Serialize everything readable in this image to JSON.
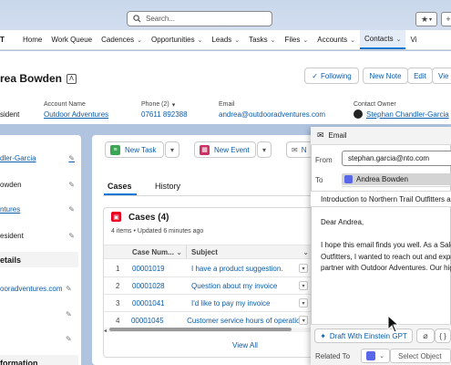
{
  "topbar": {
    "search_placeholder": "Search...",
    "nav_left_partial": "T"
  },
  "nav": {
    "items": [
      {
        "label": "Home",
        "chevron": false
      },
      {
        "label": "Work Queue",
        "chevron": false
      },
      {
        "label": "Cadences",
        "chevron": true
      },
      {
        "label": "Opportunities",
        "chevron": true
      },
      {
        "label": "Leads",
        "chevron": true
      },
      {
        "label": "Tasks",
        "chevron": true
      },
      {
        "label": "Files",
        "chevron": true
      },
      {
        "label": "Accounts",
        "chevron": true
      },
      {
        "label": "Contacts",
        "chevron": true
      },
      {
        "label": "Vi",
        "chevron": false
      }
    ],
    "active": "Contacts"
  },
  "record": {
    "name": "rea Bowden",
    "buttons": {
      "following": "Following",
      "new_note": "New Note",
      "edit": "Edit",
      "view": "Vie"
    },
    "fields": {
      "title_partial": "sident",
      "account_name_label": "Account Name",
      "account_name": "Outdoor Adventures",
      "phone_label": "Phone (2)",
      "phone": "07611 892388",
      "email_label": "Email",
      "email": "andrea@outdooradventures.com",
      "owner_label": "Contact Owner",
      "owner": "Stephan Chandler-Garcia"
    }
  },
  "left_panel": {
    "rows": [
      "dler-Garcia",
      "owden",
      "ntures",
      "esident"
    ],
    "section_details": "etails",
    "email_partial": "ooradventures.com",
    "section_bottom": "formation"
  },
  "actions": {
    "new_task": "New Task",
    "new_event": "New Event",
    "third_partial": "N"
  },
  "tabs": {
    "cases": "Cases",
    "history": "History"
  },
  "cases": {
    "title": "Cases (4)",
    "subtitle": "4 items • Updated 6 minutes ago",
    "col_number": "Case Num...",
    "col_subject": "Subject",
    "rows": [
      {
        "idx": "1",
        "number": "00001019",
        "subject": "I have a product suggestion."
      },
      {
        "idx": "2",
        "number": "00001028",
        "subject": "Question about my invoice"
      },
      {
        "idx": "3",
        "number": "00001041",
        "subject": "I'd like to pay my invoice"
      },
      {
        "idx": "4",
        "number": "00001045",
        "subject": "Customer service hours of operation."
      }
    ],
    "view_all": "View All"
  },
  "email": {
    "header": "Email",
    "from_label": "From",
    "from_value": "stephan.garcia@nto.com",
    "to_label": "To",
    "to_pill": "Andrea Bowden",
    "subject": "Introduction to Northern Trail Outfitters and",
    "body": [
      "Dear Andrea,",
      "",
      "I hope this email finds you well. As a Sales E",
      "Outfitters, I wanted to reach out and expres",
      "partner with Outdoor Adventures. Our high-"
    ],
    "draft_button": "Draft With Einstein GPT",
    "related_label": "Related To",
    "related_placeholder": "Select Object"
  },
  "colors": {
    "accent": "#0176d3",
    "link": "#0b5cab",
    "task_green": "#3ba755",
    "event_pink": "#cb3164",
    "case_red": "#ea001e",
    "header_bg": "#c8d7ea"
  }
}
